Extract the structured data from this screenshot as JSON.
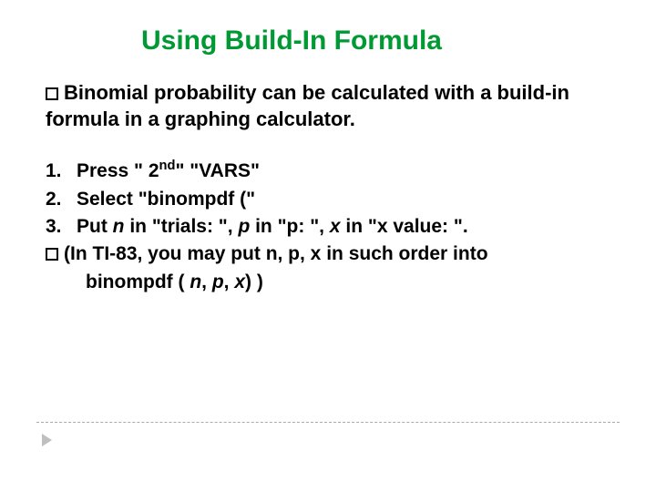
{
  "title": "Using Build-In Formula",
  "intro": {
    "bullet_prefix": "Binomial",
    "rest": " probability can be calculated with a build-in formula in a graphing calculator."
  },
  "steps": {
    "s1": {
      "num": "1.",
      "text_a": "Press \" 2",
      "sup": "nd",
      "text_b": "\" \"VARS\""
    },
    "s2": {
      "num": "2.",
      "text": "Select \"binompdf (\""
    },
    "s3": {
      "num": "3.",
      "t1": "Put ",
      "n": "n",
      "t2": " in \"trials: \",   ",
      "p": "p",
      "t3": " in \"p: \",   ",
      "x": "x",
      "t4": " in \"x value: \"."
    }
  },
  "note": {
    "line1_a": "(In",
    "line1_b": " TI-83, you may put n, p, x in such order into",
    "line2_a": "binompdf ( ",
    "n": "n",
    "c1": ", ",
    "p": "p",
    "c2": ", ",
    "x": "x",
    "line2_b": ")  )"
  }
}
